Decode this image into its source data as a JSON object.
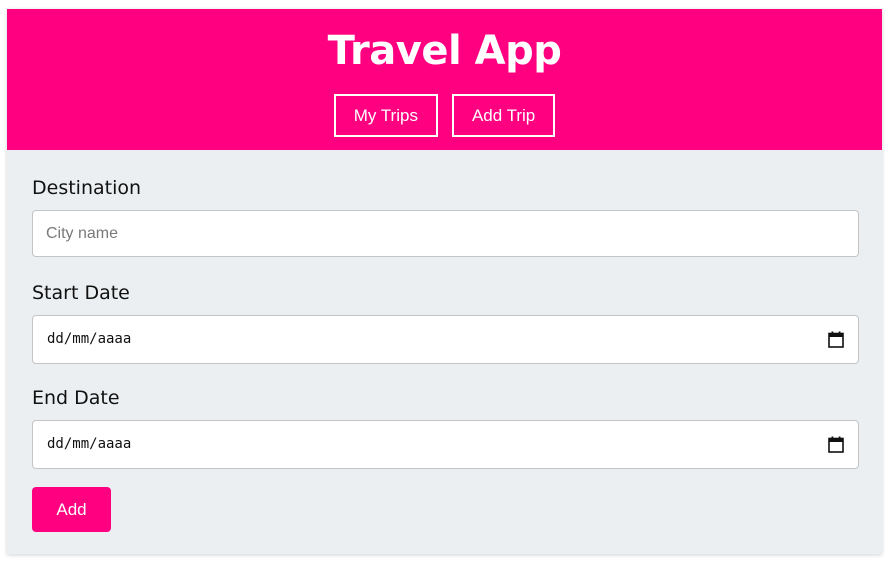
{
  "app": {
    "title": "Travel App"
  },
  "nav": {
    "my_trips_label": "My Trips",
    "add_trip_label": "Add Trip"
  },
  "form": {
    "destination": {
      "label": "Destination",
      "placeholder": "City name",
      "value": ""
    },
    "start_date": {
      "label": "Start Date",
      "display_value": "dd/mm/aaaa"
    },
    "end_date": {
      "label": "End Date",
      "display_value": "dd/mm/aaaa"
    },
    "submit_label": "Add"
  },
  "icons": {
    "date_picker": "calendar-icon"
  },
  "colors": {
    "accent": "#ff0080",
    "panel_background": "#eceff1",
    "text": "#111111"
  }
}
